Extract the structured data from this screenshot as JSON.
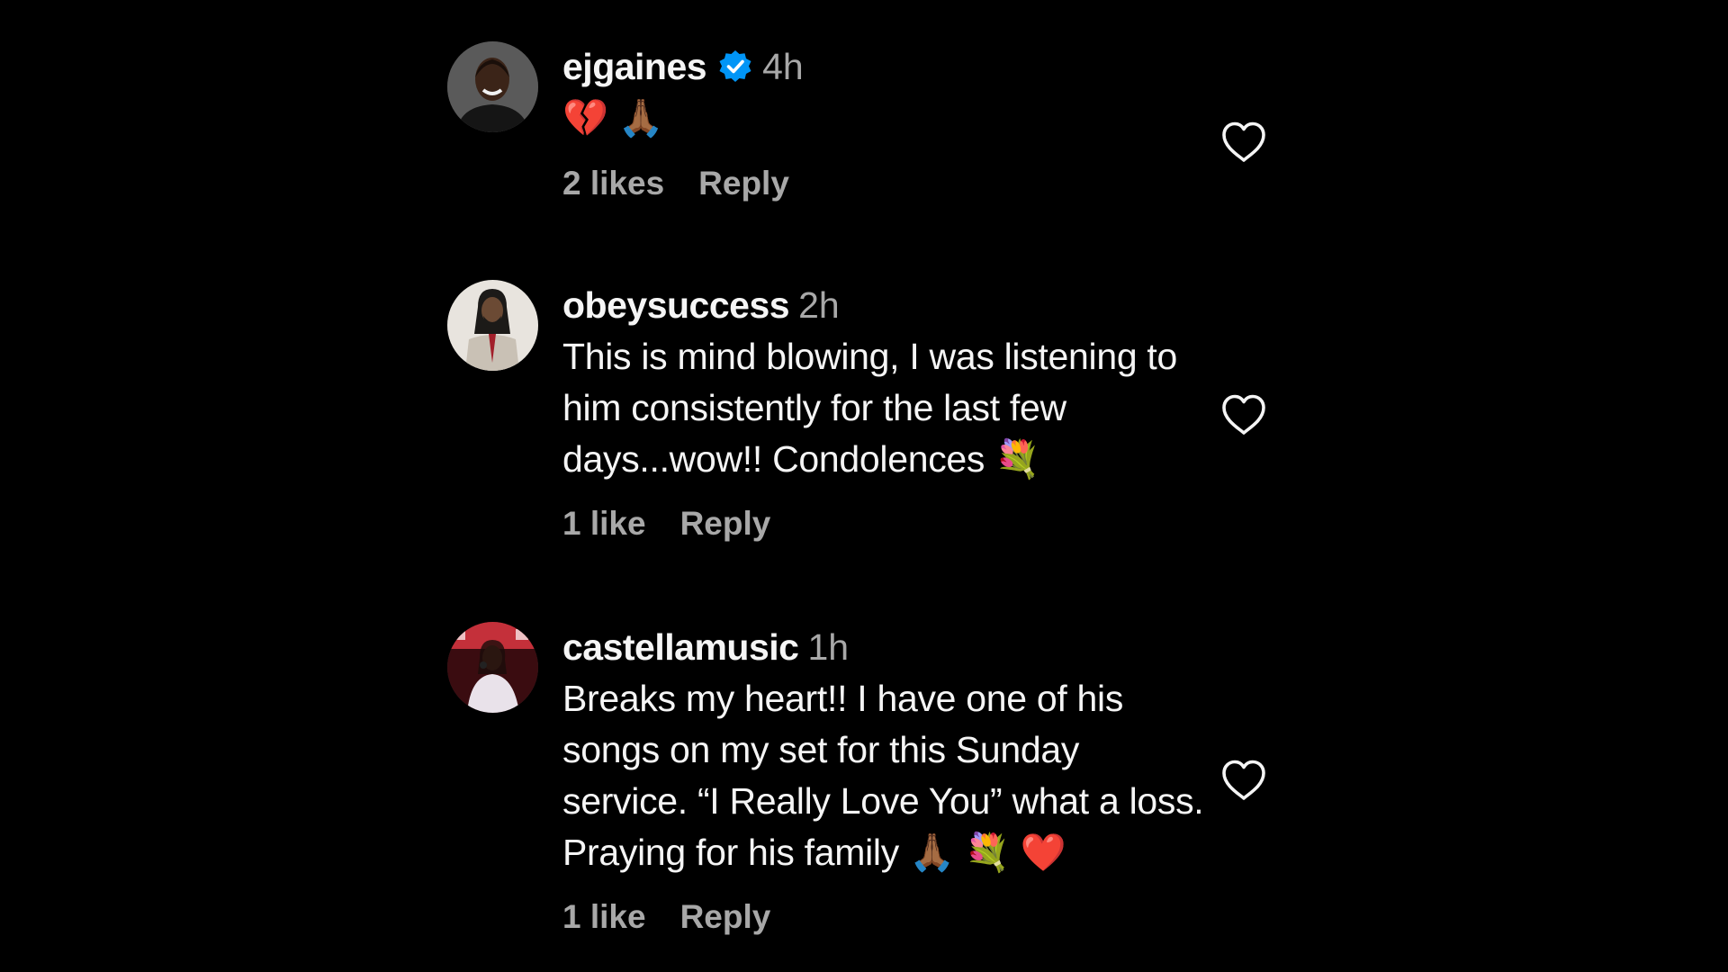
{
  "comments": [
    {
      "username": "ejgaines",
      "verified": true,
      "time": "4h",
      "text": "💔 🙏🏾",
      "likes": "2 likes",
      "reply": "Reply",
      "avatar": "man-smiling-photo"
    },
    {
      "username": "obeysuccess",
      "verified": false,
      "time": "2h",
      "text": "This is mind blowing, I was listening to him consistently for the last few days...wow!! Condolences 💐",
      "likes": "1 like",
      "reply": "Reply",
      "avatar": "man-in-suit-photo"
    },
    {
      "username": "castellamusic",
      "verified": false,
      "time": "1h",
      "text": "Breaks my heart!! I have one of his songs on my set for this Sunday service. “I Really Love You” what a loss. Praying for his family 🙏🏾 💐 ❤️",
      "likes": "1 like",
      "reply": "Reply",
      "avatar": "singer-on-stage-photo"
    }
  ],
  "colors": {
    "background": "#000000",
    "primary_text": "#f5f5f5",
    "secondary_text": "#a8a8a8",
    "verified_badge": "#0095f6"
  },
  "icons": {
    "like": "heart-outline-icon",
    "verified": "verified-badge-icon"
  }
}
